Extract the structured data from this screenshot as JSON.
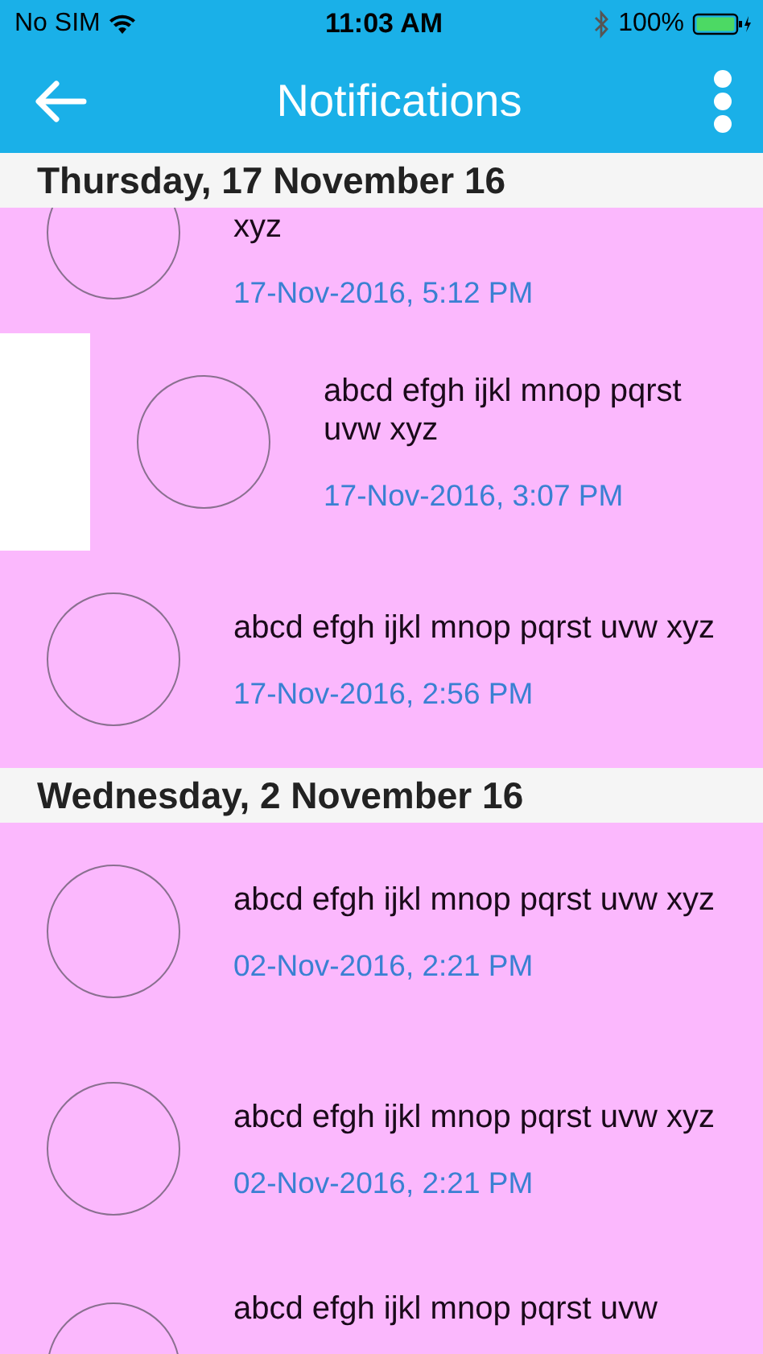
{
  "status_bar": {
    "carrier": "No SIM",
    "time": "11:03 AM",
    "battery": "100%"
  },
  "nav": {
    "title": "Notifications"
  },
  "sections": [
    {
      "header": "Thursday, 17 November 16",
      "rows": [
        {
          "kind": "cut_top",
          "message": "xyz",
          "time": "17-Nov-2016, 5:12 PM",
          "swiped": false
        },
        {
          "kind": "full",
          "message": "abcd efgh ijkl mnop pqrst uvw xyz",
          "time": "17-Nov-2016, 3:07 PM",
          "swiped": true
        },
        {
          "kind": "full",
          "message": "abcd efgh ijkl mnop pqrst uvw xyz",
          "time": "17-Nov-2016, 2:56 PM",
          "swiped": false
        }
      ]
    },
    {
      "header": "Wednesday, 2 November 16",
      "rows": [
        {
          "kind": "full",
          "message": "abcd efgh ijkl mnop pqrst uvw xyz",
          "time": "02-Nov-2016, 2:21 PM",
          "swiped": false
        },
        {
          "kind": "full",
          "message": "abcd efgh ijkl mnop pqrst uvw xyz",
          "time": "02-Nov-2016, 2:21 PM",
          "swiped": false
        },
        {
          "kind": "cut_bottom",
          "message": "abcd efgh ijkl mnop pqrst uvw",
          "swiped": false
        }
      ]
    }
  ]
}
